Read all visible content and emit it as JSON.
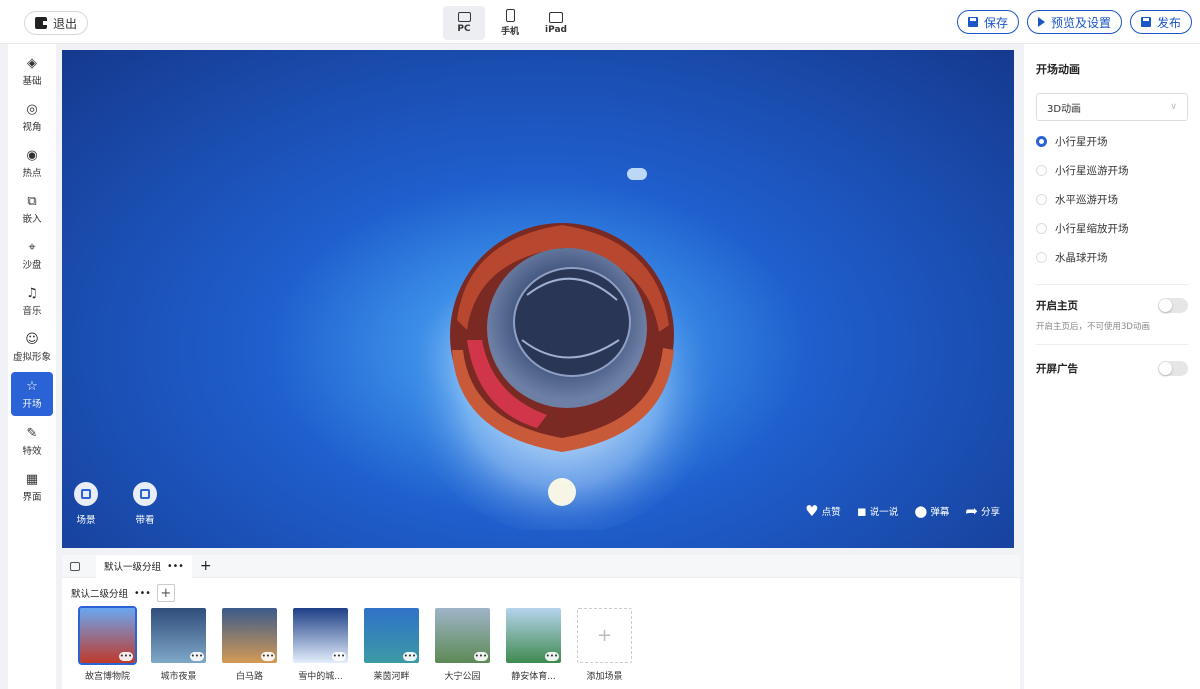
{
  "topbar": {
    "exit_label": "退出",
    "devices": [
      {
        "label": "PC",
        "icon": "monitor-icon"
      },
      {
        "label": "手机",
        "icon": "phone-icon"
      },
      {
        "label": "iPad",
        "icon": "tablet-icon"
      }
    ],
    "save_label": "保存",
    "preview_label": "预览及设置",
    "publish_label": "发布"
  },
  "sidebar": {
    "items": [
      {
        "label": "基础",
        "glyph": "◈",
        "icon": "layers-icon"
      },
      {
        "label": "视角",
        "glyph": "◎",
        "icon": "view-angle-icon"
      },
      {
        "label": "热点",
        "glyph": "◉",
        "icon": "hotspot-icon"
      },
      {
        "label": "嵌入",
        "glyph": "⧉",
        "icon": "embed-icon"
      },
      {
        "label": "沙盘",
        "glyph": "⌖",
        "icon": "sandbox-icon"
      },
      {
        "label": "音乐",
        "glyph": "♫",
        "icon": "music-icon"
      },
      {
        "label": "虚拟形象",
        "glyph": "☺",
        "icon": "avatar-icon"
      },
      {
        "label": "开场",
        "glyph": "☆",
        "icon": "opening-icon"
      },
      {
        "label": "特效",
        "glyph": "✎",
        "icon": "effects-icon"
      },
      {
        "label": "界面",
        "glyph": "▦",
        "icon": "interface-icon"
      }
    ]
  },
  "stage": {
    "scene_btn_label": "场景",
    "guide_btn_label": "带看",
    "like_label": "点赞",
    "comment_label": "说一说",
    "danmaku_label": "弹幕",
    "share_label": "分享"
  },
  "scenes": {
    "group1_label": "默认一级分组",
    "group2_label": "默认二级分组",
    "more": "•••",
    "plus": "+",
    "dots": "•••",
    "items": [
      {
        "label": "故宫博物院",
        "colors": [
          "#6aa7f0",
          "#c0392b"
        ]
      },
      {
        "label": "城市夜景",
        "colors": [
          "#2f4d7a",
          "#7fa8c8"
        ]
      },
      {
        "label": "白马路",
        "colors": [
          "#3c5a8a",
          "#d49a55"
        ]
      },
      {
        "label": "雪中的城...",
        "colors": [
          "#1d3f86",
          "#e4eefc"
        ]
      },
      {
        "label": "莱茵河畔",
        "colors": [
          "#2f72c8",
          "#3c9aa5"
        ]
      },
      {
        "label": "大宁公园",
        "colors": [
          "#9fb4c8",
          "#5c8a55"
        ]
      },
      {
        "label": "静安体育...",
        "colors": [
          "#b6d4ee",
          "#3f8a4f"
        ]
      }
    ],
    "add_label": "添加场景"
  },
  "panel": {
    "opening_title": "开场动画",
    "animation_select": "3D动画",
    "options": [
      {
        "label": "小行星开场",
        "checked": true
      },
      {
        "label": "小行星巡游开场",
        "checked": false
      },
      {
        "label": "水平巡游开场",
        "checked": false
      },
      {
        "label": "小行星缩放开场",
        "checked": false
      },
      {
        "label": "水晶球开场",
        "checked": false
      }
    ],
    "homepage_title": "开启主页",
    "homepage_hint": "开启主页后，不可使用3D动画",
    "splash_ad_title": "开屏广告"
  }
}
